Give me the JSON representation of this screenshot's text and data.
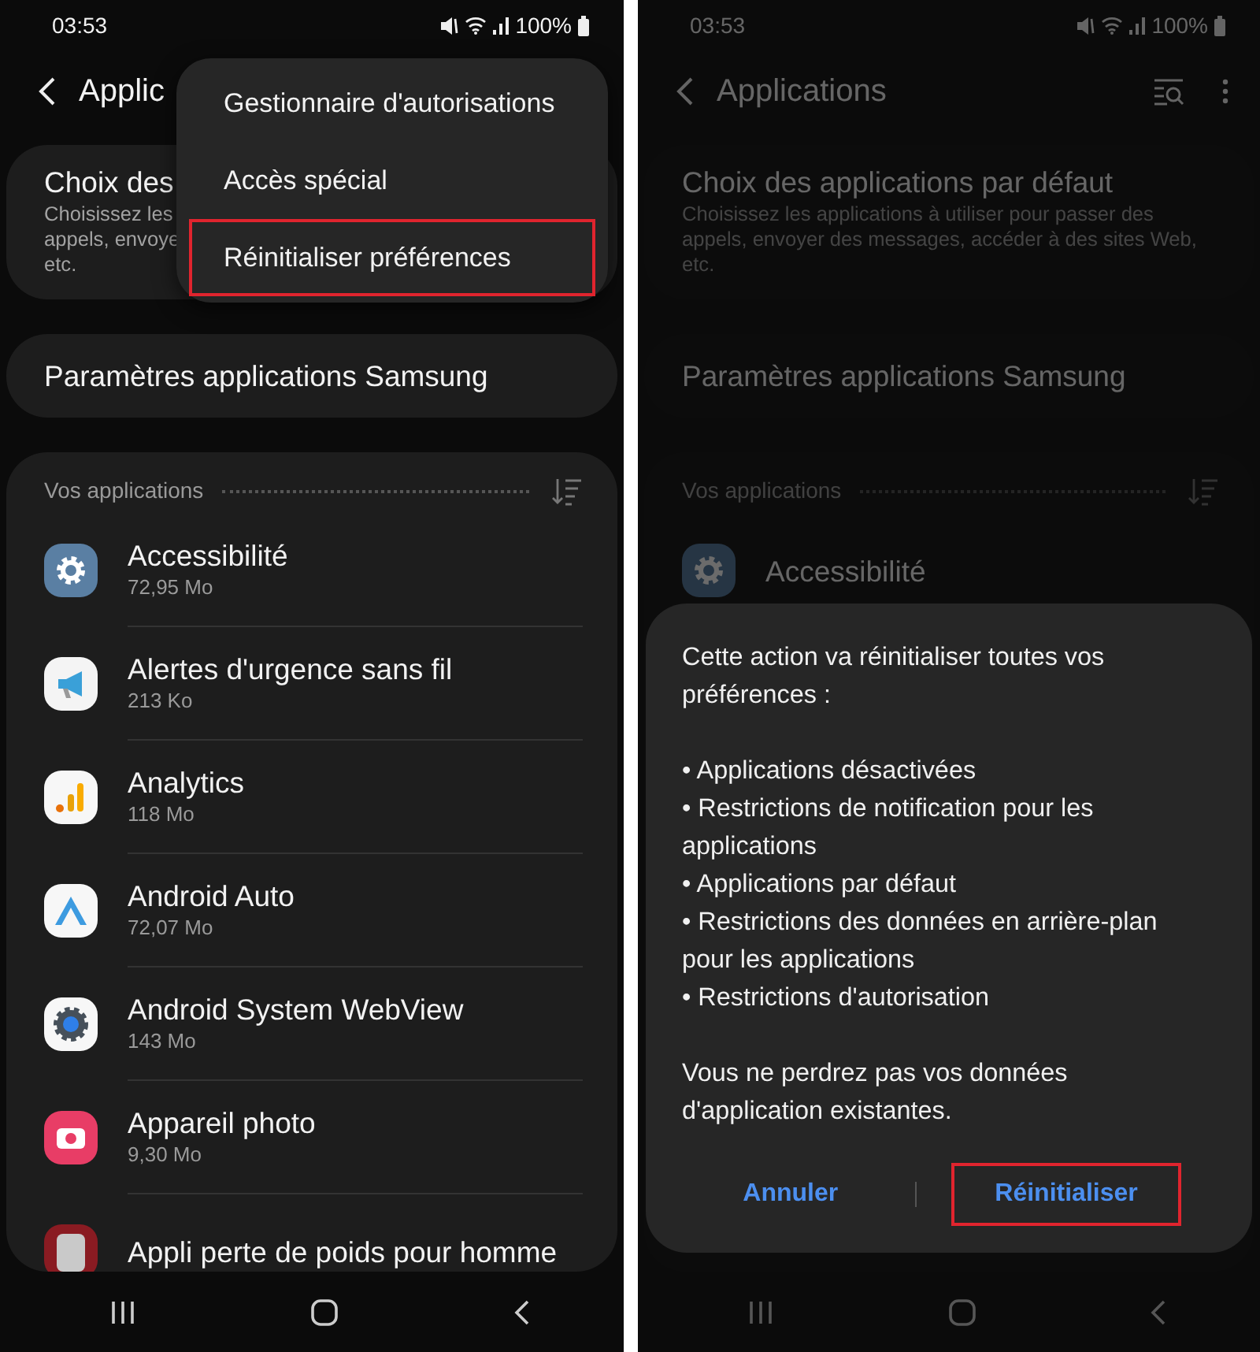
{
  "screens": [
    {
      "dimmed": false,
      "status_bar": {
        "time": "03:53",
        "battery": "100%"
      },
      "header": {
        "title": "Applic"
      },
      "default_apps": {
        "title": "Choix des",
        "subtitle_lines": [
          "Choisissez les",
          "appels, envoye",
          "etc."
        ]
      },
      "samsung_settings": {
        "title": "Paramètres applications Samsung"
      },
      "apps_section": {
        "title": "Vos applications",
        "apps": [
          {
            "name": "Accessibilité",
            "size": "72,95 Mo",
            "kind": "gear"
          },
          {
            "name": "Alertes d'urgence sans fil",
            "size": "213 Ko",
            "kind": "megaphone"
          },
          {
            "name": "Analytics",
            "size": "118 Mo",
            "kind": "bars"
          },
          {
            "name": "Android Auto",
            "size": "72,07 Mo",
            "kind": "chevron"
          },
          {
            "name": "Android System WebView",
            "size": "143 Mo",
            "kind": "webview"
          },
          {
            "name": "Appareil photo",
            "size": "9,30 Mo",
            "kind": "camera"
          },
          {
            "name": "Appli perte de poids pour homme",
            "kind": "picture"
          }
        ]
      },
      "menu": {
        "items": [
          {
            "label": "Gestionnaire d'autorisations",
            "annotated": false
          },
          {
            "label": "Accès spécial",
            "annotated": false
          },
          {
            "label": "Réinitialiser préférences",
            "annotated": true
          }
        ]
      }
    },
    {
      "dimmed": true,
      "status_bar": {
        "time": "03:53",
        "battery": "100%"
      },
      "header": {
        "title": "Applications"
      },
      "default_apps": {
        "title": "Choix des applications par défaut",
        "subtitle_lines": [
          "Choisissez les applications à utiliser pour passer des",
          "appels, envoyer des messages, accéder à des sites Web,",
          "etc."
        ]
      },
      "samsung_settings": {
        "title": "Paramètres applications Samsung"
      },
      "apps_section": {
        "title": "Vos applications",
        "apps": [
          {
            "name": "Accessibilité",
            "kind": "gear"
          }
        ]
      },
      "dialog": {
        "intro": "Cette action va réinitialiser toutes vos préférences :",
        "bullets": [
          "• Applications désactivées",
          "• Restrictions de notification pour les applications",
          "• Applications par défaut",
          "• Restrictions des données en arrière-plan pour les applications",
          "• Restrictions d'autorisation"
        ],
        "note": "Vous ne perdrez pas vos données d'application existantes.",
        "buttons": [
          {
            "label": "Annuler",
            "annotated": false
          },
          {
            "label": "Réinitialiser",
            "annotated": true
          }
        ]
      }
    }
  ]
}
